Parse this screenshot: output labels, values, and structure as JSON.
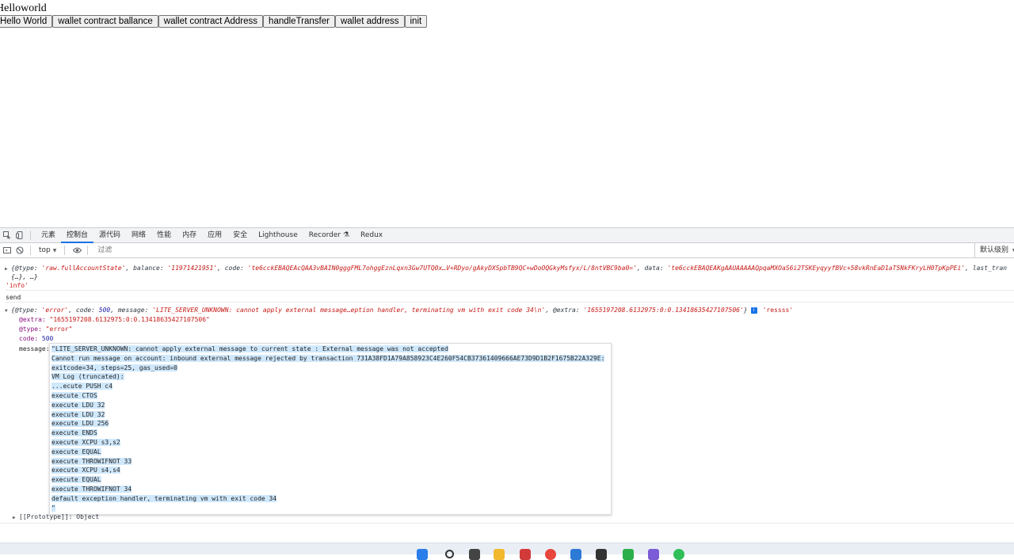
{
  "page": {
    "heading": "Helloworld",
    "buttons": [
      "Hello World",
      "wallet contract ballance",
      "wallet contract Address",
      "handleTransfer",
      "wallet address",
      "init"
    ]
  },
  "devtools": {
    "tabs": [
      {
        "label": "元素",
        "active": false
      },
      {
        "label": "控制台",
        "active": true
      },
      {
        "label": "源代码",
        "active": false
      },
      {
        "label": "网络",
        "active": false
      },
      {
        "label": "性能",
        "active": false
      },
      {
        "label": "内存",
        "active": false
      },
      {
        "label": "应用",
        "active": false
      },
      {
        "label": "安全",
        "active": false
      },
      {
        "label": "Lighthouse",
        "active": false
      },
      {
        "label": "Recorder ⚗",
        "active": false
      },
      {
        "label": "Redux",
        "active": false
      }
    ],
    "toolbar": {
      "context": "top",
      "filter_placeholder": "过滤",
      "levels": "默认级别"
    }
  },
  "console": {
    "line1_prefix": "{@type: ",
    "line1_type": "'raw.fullAccountState'",
    "line1_balance_key": ", balance: ",
    "line1_balance": "'11971421951'",
    "line1_code_key": ", code: ",
    "line1_code": "'te6cckEBAQEAcQAA3vBAIN0gggFML7ohggEznLqxn3Gw7UTQ0x…V+RDyo/gAkyDXSpbTB9QC+wDoOQGkyMsfyx/L/8ntVBC9ba0='",
    "line1_data_key": ", data: ",
    "line1_data": "'te6cckEBAQEAKgAAUAAAAAQpqaMXOaS6i2TSKEyqyyfBVc+58vkRnEaD1aT5NkFKryLH0TpKpPEi'",
    "line1_tail": ", last_tran",
    "line2": "{…}, …}",
    "info_string": "'info'",
    "send": "send",
    "err_open": "{@type: ",
    "err_type": "'error'",
    "err_code_key": ", code: ",
    "err_code": "500",
    "err_msg_key": ", message: ",
    "err_msg": "'LITE_SERVER_UNKNOWN: cannot apply external message…eption handler, terminating vm with exit code 34\\n'",
    "err_extra_key": ", @extra: ",
    "err_extra": "'1655197208.6132975:0:0.13418635427107506'",
    "err_close": "}",
    "info_badge": "i",
    "ressss": "'ressss'",
    "extra_key": "@extra:",
    "extra_val": "\"1655197208.6132975:0:0.13418635427107506\"",
    "type_key": "@type:",
    "type_val": "\"error\"",
    "code_key": "code:",
    "code_val": "500",
    "message_key": "message:",
    "prototype": "[[Prototype]]: Object"
  },
  "message_lines": [
    "\"LITE_SERVER_UNKNOWN: cannot apply external message to current state : External message was not accepted",
    "Cannot run message on account: inbound external message rejected by transaction 731A38FD1A79A858923C4E260F54CB37361409666AE73D9D1B2F1675B22A329E:",
    "exitcode=34, steps=25, gas_used=0",
    "VM Log (truncated):",
    "...ecute PUSH c4",
    "execute CTOS",
    "execute LDU 32",
    "execute LDU 32",
    "execute LDU 256",
    "execute ENDS",
    "execute XCPU s3,s2",
    "execute EQUAL",
    "execute THROWIFNOT 33",
    "execute XCPU s4,s4",
    "execute EQUAL",
    "execute THROWIFNOT 34",
    "default exception handler, terminating vm with exit code 34",
    "\""
  ],
  "colors": {
    "string": "#c41a16",
    "number": "#1a1aa6",
    "key": "#881280",
    "selection": "#cfe8fc",
    "active_tab": "#1a73e8"
  }
}
